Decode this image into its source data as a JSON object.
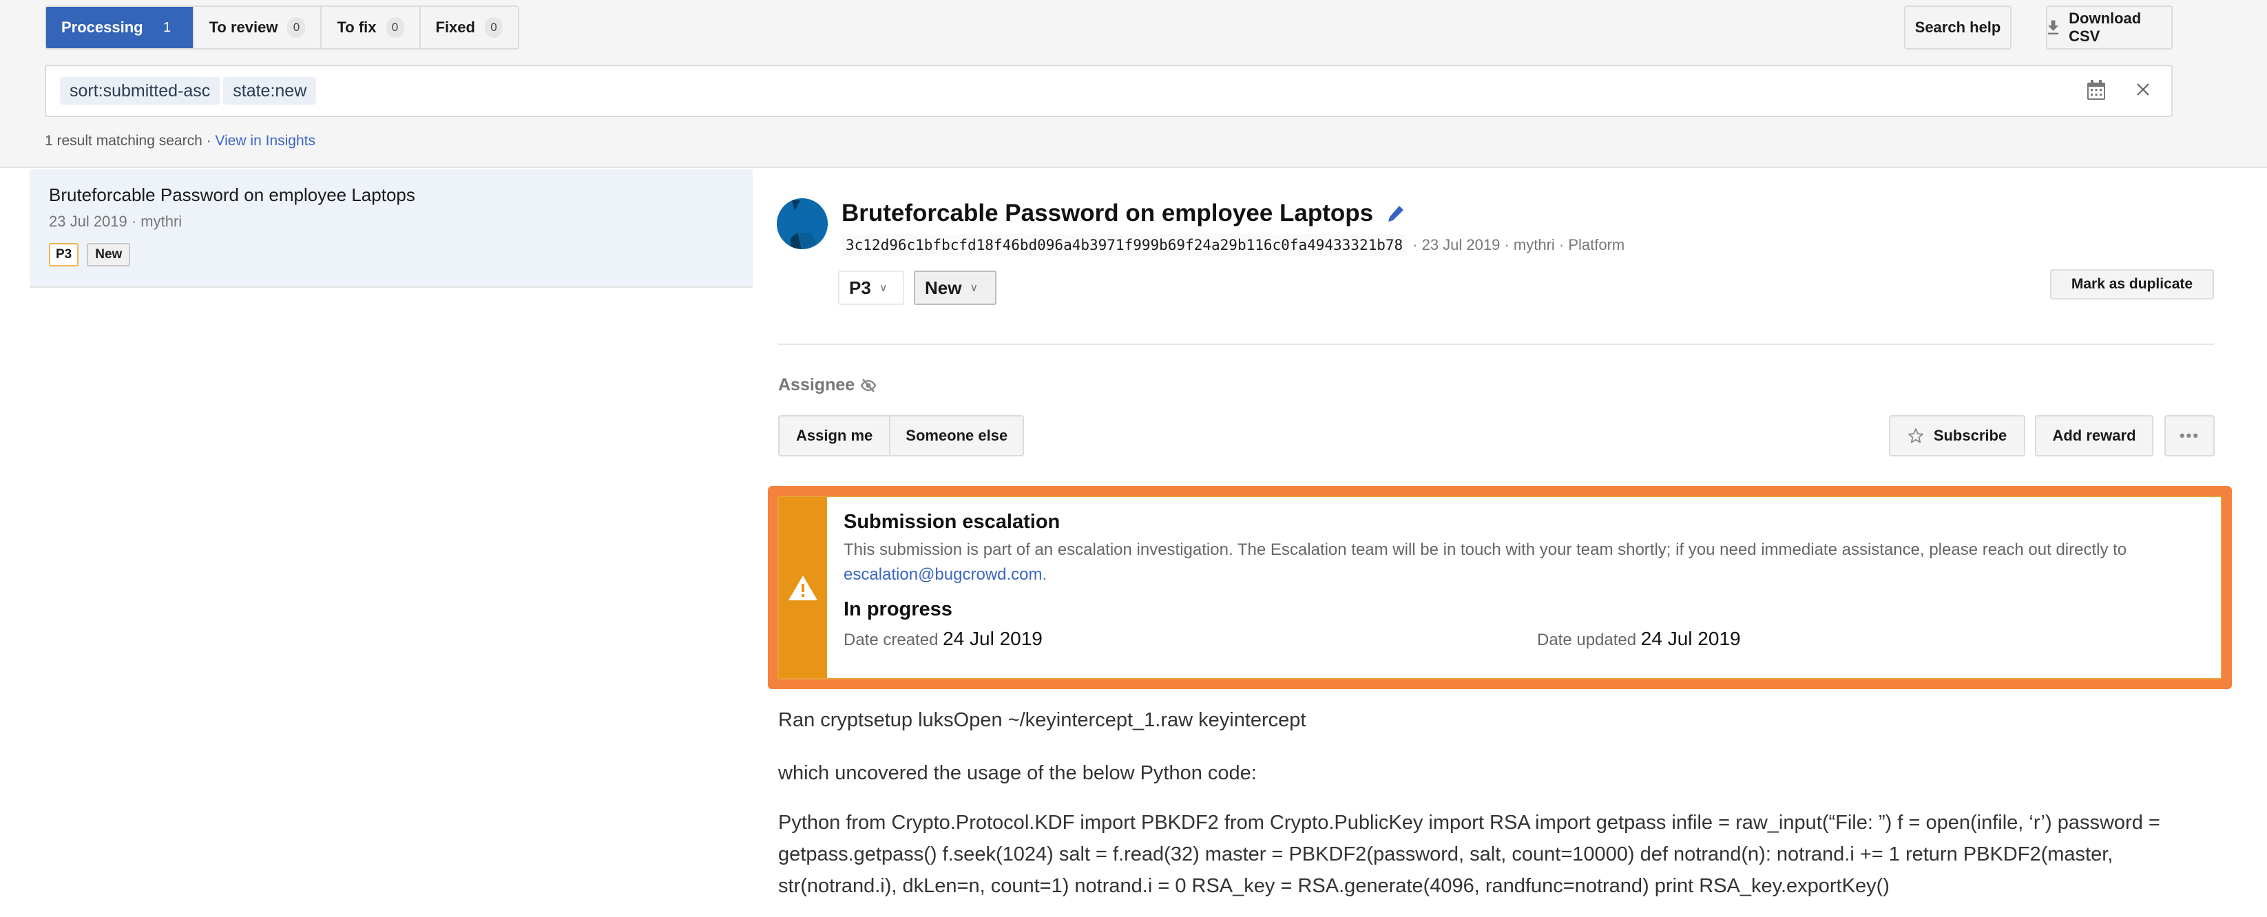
{
  "tabs": [
    {
      "label": "Processing",
      "count": "1",
      "active": true
    },
    {
      "label": "To review",
      "count": "0"
    },
    {
      "label": "To fix",
      "count": "0"
    },
    {
      "label": "Fixed",
      "count": "0"
    }
  ],
  "toolbar": {
    "search_help_label": "Search help",
    "download_csv_label": "Download CSV"
  },
  "search": {
    "chips": [
      "sort:submitted-asc",
      "state:new"
    ]
  },
  "results": {
    "summary": "1 result matching search",
    "separator": " · ",
    "insights_link": "View in Insights"
  },
  "list": {
    "items": [
      {
        "title": "Bruteforcable Password on employee Laptops",
        "meta": "23 Jul 2019 · mythri",
        "priority": "P3",
        "state": "New"
      }
    ]
  },
  "detail": {
    "title": "Bruteforcable Password on employee Laptops",
    "hash": "3c12d96c1bfbcfd18f46bd096a4b3971f999b69f24a29b116c0fa49433321b78",
    "meta": "· 23 Jul 2019 · mythri · Platform",
    "priority": "P3",
    "state": "New",
    "mark_duplicate_label": "Mark as duplicate",
    "assignee_label": "Assignee",
    "assign_me_label": "Assign me",
    "someone_else_label": "Someone else",
    "subscribe_label": "Subscribe",
    "add_reward_label": "Add reward",
    "more_label": "•••"
  },
  "escalation": {
    "title": "Submission escalation",
    "text": "This submission is part of an escalation investigation. The Escalation team will be in touch with your team shortly; if you need immediate assistance, please reach out directly to ",
    "email": "escalation@bugcrowd.com",
    "text_end": ".",
    "status": "In progress",
    "date_created_label": "Date created",
    "date_created": "24 Jul 2019",
    "date_updated_label": "Date updated",
    "date_updated": "24 Jul 2019",
    "colors": {
      "highlight": "#f5823c",
      "strip": "#e89416"
    }
  },
  "body": {
    "paragraphs": [
      "Ran cryptsetup luksOpen ~/keyintercept_1.raw keyintercept",
      "which uncovered the usage of the below Python code:",
      "Python from Crypto.Protocol.KDF import PBKDF2 from Crypto.PublicKey import RSA import getpass infile = raw_input(“File: ”) f = open(infile, ‘r’) password = getpass.getpass() f.seek(1024) salt = f.read(32) master = PBKDF2(password, salt, count=10000) def notrand(n): notrand.i += 1 return PBKDF2(master, str(notrand.i), dkLen=n, count=1) notrand.i = 0 RSA_key = RSA.generate(4096, randfunc=notrand) print RSA_key.exportKey()"
    ]
  },
  "colors": {
    "accent": "#3465b9",
    "link": "#3a66c4",
    "avatar": "#0b6aac"
  }
}
